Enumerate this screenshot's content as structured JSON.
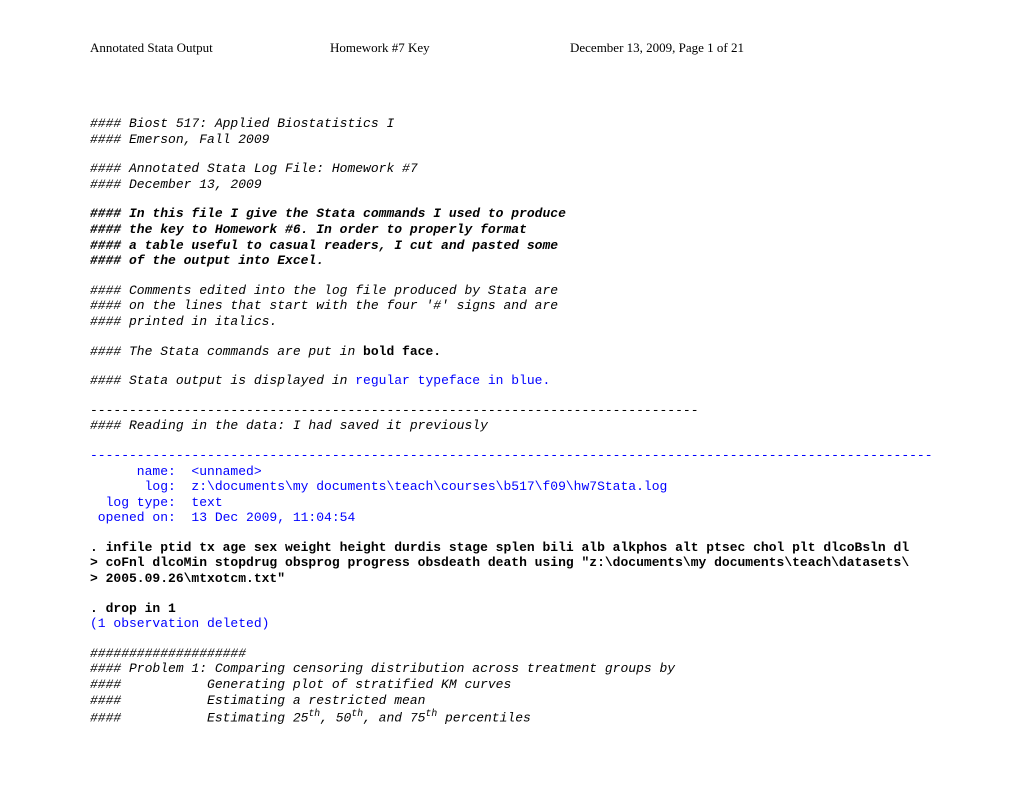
{
  "header": {
    "left": "Annotated Stata Output",
    "center": "Homework #7 Key",
    "right": "December 13, 2009, Page 1 of 21"
  },
  "intro1_line1": "#### Biost 517: Applied Biostatistics I",
  "intro1_line2": "#### Emerson, Fall 2009",
  "intro2_line1": "#### Annotated Stata Log File: Homework #7",
  "intro2_line2": "#### December 13, 2009",
  "intro3_line1": "#### In this file I give the Stata commands I used to produce",
  "intro3_line2": "#### the key to Homework #6. In order to properly format",
  "intro3_line3": "#### a table useful to casual readers, I cut and pasted some",
  "intro3_line4": "#### of the output into Excel.",
  "intro4_line1": "#### Comments edited into the log file produced by Stata are",
  "intro4_line2": "#### on the lines that start with the four '#' signs and are",
  "intro4_line3": "#### printed in italics.",
  "intro5_prefix": "#### The Stata commands are put in ",
  "intro5_bold": "bold face.",
  "intro6_prefix": "#### Stata output is displayed in ",
  "intro6_blue": "regular typeface in blue.",
  "dashes1": "------------------------------------------------------------------------------",
  "reading": "#### Reading in the data: I had saved it previously",
  "dashes2": "------------------------------------------------------------------------------------------------------------",
  "log_name": "      name:  <unnamed>",
  "log_path": "       log:  z:\\documents\\my documents\\teach\\courses\\b517\\f09\\hw7Stata.log",
  "log_type": "  log type:  text",
  "log_opened": " opened on:  13 Dec 2009, 11:04:54",
  "cmd_infile1": ". infile ptid tx age sex weight height durdis stage splen bili alb alkphos alt ptsec chol plt dlcoBsln dl",
  "cmd_infile2": "> coFnl dlcoMin stopdrug obsprog progress obsdeath death using \"z:\\documents\\my documents\\teach\\datasets\\",
  "cmd_infile3": "> 2005.09.26\\mtxotcm.txt\"",
  "cmd_drop": ". drop in 1",
  "out_drop": "(1 observation deleted)",
  "prob_header": "####################",
  "prob_line1": "#### Problem 1: Comparing censoring distribution across treatment groups by",
  "prob_line2": "####           Generating plot of stratified KM curves",
  "prob_line3": "####           Estimating a restricted mean",
  "prob_line4_prefix": "####           Estimating 25",
  "prob_line4_mid1": ", 50",
  "prob_line4_mid2": ", and 75",
  "prob_line4_suffix": " percentiles",
  "th": "th"
}
